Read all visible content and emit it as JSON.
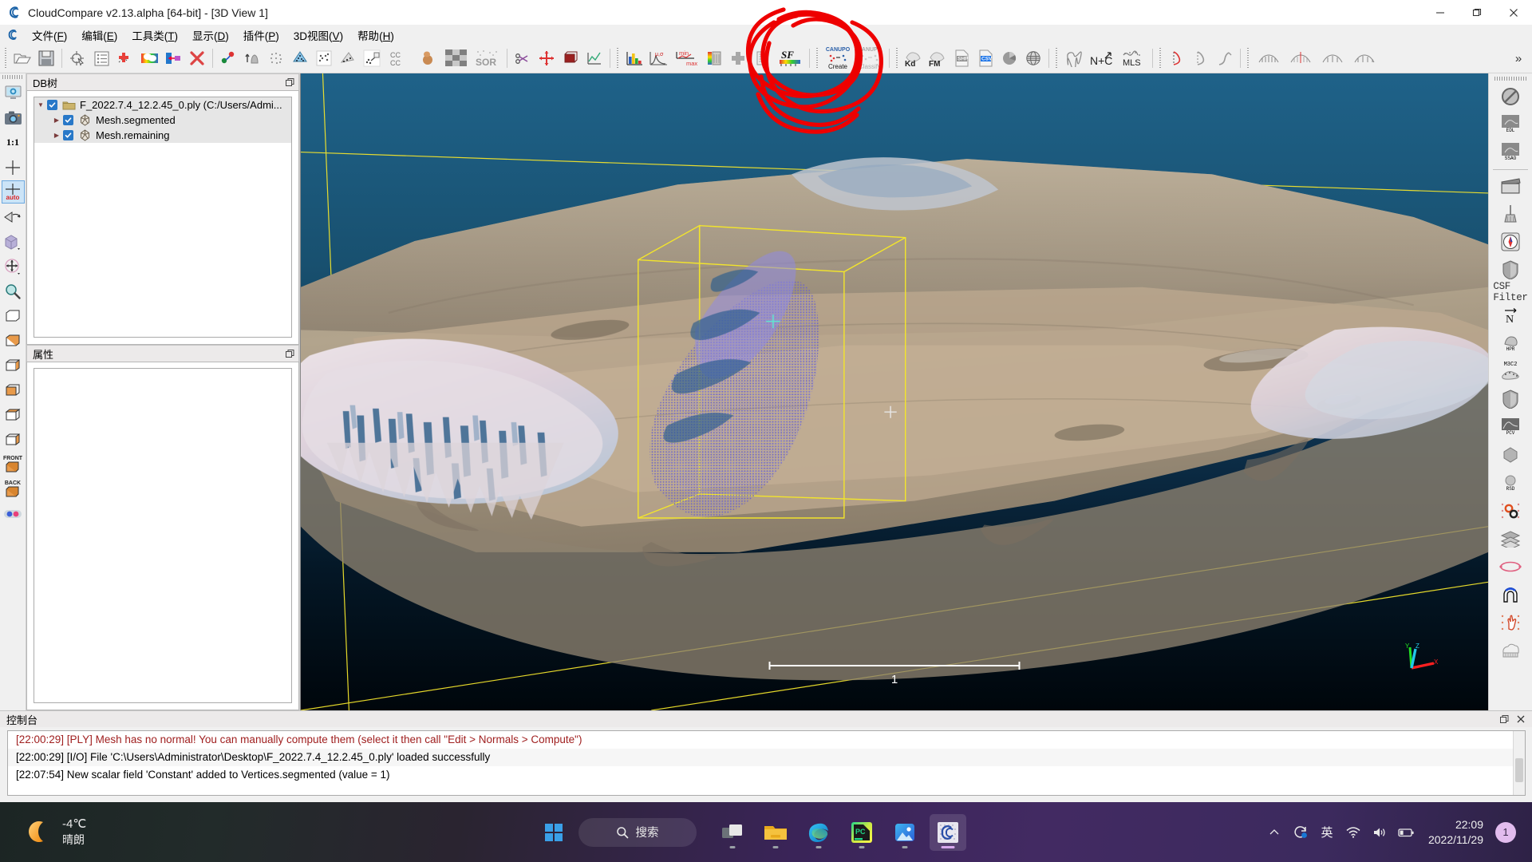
{
  "window": {
    "title": "CloudCompare v2.13.alpha [64-bit] - [3D View 1]",
    "logo_icon": "cloudcompare-logo-icon",
    "minimize_label": "—",
    "maximize_label": "❐",
    "close_label": "✕"
  },
  "menubar": {
    "logo_icon": "cloudcompare-menu-icon",
    "items": [
      {
        "label": "文件",
        "key": "F"
      },
      {
        "label": "编辑",
        "key": "E"
      },
      {
        "label": "工具类",
        "key": "T"
      },
      {
        "label": "显示",
        "key": "D"
      },
      {
        "label": "插件",
        "key": "P"
      },
      {
        "label": "3D视图",
        "key": "V"
      },
      {
        "label": "帮助",
        "key": "H"
      }
    ]
  },
  "toolbar": {
    "groups": [
      {
        "icons": [
          "open-file-icon",
          "save-file-icon"
        ]
      },
      {
        "icons": [
          "pick-point-icon",
          "properties-list-icon",
          "add-point-icon",
          "rainbow-colors-icon",
          "export-icon",
          "delete-icon"
        ]
      },
      {
        "icons": [
          "clone-icon",
          "normals-up-icon",
          "subsample-icon",
          "mesh-icon",
          "scatter-match-icon",
          "register-icon",
          "align-icon",
          "cloud-cloud-dist-icon",
          "ball-icon",
          "checker-icon",
          "sor-filter-icon"
        ]
      },
      {
        "icons": [
          "scissors-icon",
          "translate-rotate-icon",
          "bounding-box-icon",
          "plot-icon"
        ]
      },
      {
        "icons": [
          "histogram-icon",
          "gauss-fit-icon",
          "min-max-icon",
          "gradient-icon",
          "add-sf-icon",
          "sf-list-icon",
          "sf-color-icon"
        ]
      },
      {
        "icons": [
          "canupo-create-icon",
          "canupo-classify-icon"
        ]
      },
      {
        "icons": [
          "kdtree-icon",
          "fast-marching-icon",
          "shp-icon",
          "csv-icon",
          "pie-icon",
          "globe-icon"
        ]
      },
      {
        "icons": [
          "polygon-icon",
          "normals-compute-icon",
          "mls-icon"
        ]
      },
      {
        "icons": [
          "curve-icon",
          "curve2-icon",
          "curve3-icon"
        ]
      },
      {
        "icons": [
          "section-icon",
          "section2-icon",
          "section3-icon",
          "section4-icon"
        ]
      }
    ],
    "canupo_create_label": "CANUPO",
    "canupo_create_sub": "Create",
    "canupo_classify_label": "CANUPO",
    "canupo_classify_sub": "Classify",
    "kd_label": "Kd",
    "fm_label": "FM",
    "shp_label": "SHP",
    "csv_label": "CSV",
    "nc_label": "N+C",
    "mls_label": "MLS",
    "sf_label": "SF",
    "sor_label": "SOR",
    "cc_label": "CC",
    "minmax_min": "min",
    "minmax_max": "max",
    "gauss_label": "μ,σ",
    "overflow_label": "»"
  },
  "left_rail": {
    "items": [
      {
        "icon": "display-settings-icon",
        "label": ""
      },
      {
        "icon": "camera-snapshot-icon",
        "label": ""
      },
      {
        "icon": "zoom-1to1-icon",
        "label": "1:1"
      },
      {
        "icon": "set-pivot-icon",
        "label": ""
      },
      {
        "icon": "auto-pivot-icon",
        "label": "auto",
        "selected": true
      },
      {
        "icon": "rotate-view-icon",
        "label": ""
      },
      {
        "icon": "cube-view-icon",
        "label": ""
      },
      {
        "icon": "pan-view-icon",
        "label": ""
      },
      {
        "icon": "zoom-icon",
        "label": ""
      },
      {
        "icon": "view-top-icon",
        "label": ""
      },
      {
        "icon": "view-bottom-icon",
        "label": ""
      },
      {
        "icon": "view-left-icon",
        "label": ""
      },
      {
        "icon": "view-right-icon",
        "label": ""
      },
      {
        "icon": "view-iso1-icon",
        "label": ""
      },
      {
        "icon": "view-iso2-icon",
        "label": ""
      },
      {
        "icon": "view-front-icon",
        "label": "FRONT"
      },
      {
        "icon": "view-back-icon",
        "label": "BACK"
      },
      {
        "icon": "stereo-mode-icon",
        "label": ""
      }
    ]
  },
  "right_rail": {
    "items": [
      {
        "icon": "no-filter-icon",
        "label": ""
      },
      {
        "icon": "edl-shader-icon",
        "label": "EDL"
      },
      {
        "icon": "ssao-shader-icon",
        "label": "SSAO"
      },
      {
        "icon": "animation-icon",
        "label": ""
      },
      {
        "icon": "broom-cleaner-icon",
        "label": ""
      },
      {
        "icon": "compass-icon",
        "label": ""
      },
      {
        "icon": "shield-icon",
        "label": ""
      },
      {
        "icon": "csf-filter-icon",
        "label": "CSF Filter"
      },
      {
        "icon": "normal-vector-icon",
        "label": "N"
      },
      {
        "icon": "hpr-icon",
        "label": "HPR"
      },
      {
        "icon": "m3c2-icon",
        "label": "M3C2"
      },
      {
        "icon": "shield2-icon",
        "label": ""
      },
      {
        "icon": "pcv-icon",
        "label": "PCV"
      },
      {
        "icon": "polyhedron-icon",
        "label": ""
      },
      {
        "icon": "rsd-icon",
        "label": "RSD"
      },
      {
        "icon": "gears-icon",
        "label": ""
      },
      {
        "icon": "layers-icon",
        "label": ""
      },
      {
        "icon": "ellipse-icon",
        "label": ""
      },
      {
        "icon": "tunnel-icon",
        "label": ""
      },
      {
        "icon": "hand-pick-icon",
        "label": ""
      },
      {
        "icon": "cloud-comb-icon",
        "label": ""
      }
    ]
  },
  "db_panel": {
    "title": "DB树",
    "float_icon": "float-panel-icon",
    "tree": [
      {
        "label": "F_2022.7.4_12.2.45_0.ply (C:/Users/Admi...",
        "icon": "folder-icon",
        "arrow": "down",
        "depth": 0,
        "checked": true
      },
      {
        "label": "Mesh.segmented",
        "icon": "mesh-icon",
        "arrow": "right",
        "depth": 1,
        "checked": true
      },
      {
        "label": "Mesh.remaining",
        "icon": "mesh-icon",
        "arrow": "right",
        "depth": 1,
        "checked": true
      }
    ]
  },
  "props_panel": {
    "title": "属性",
    "float_icon": "float-panel-icon",
    "rows": []
  },
  "console": {
    "title": "控制台",
    "float_icon": "float-panel-icon",
    "close_icon": "close-icon",
    "lines": [
      {
        "text": "[22:00:29] [PLY] Mesh has no normal! You can manually compute them (select it then call \"Edit > Normals > Compute\")",
        "type": "warn"
      },
      {
        "text": "[22:00:29] [I/O] File 'C:\\Users\\Administrator\\Desktop\\F_2022.7.4_12.2.45_0.ply' loaded successfully",
        "type": "info"
      },
      {
        "text": "[22:07:54] New scalar field 'Constant' added to Vertices.segmented (value = 1)",
        "type": "info"
      }
    ]
  },
  "viewport": {
    "scalebar_label": "1",
    "axis_x": "X",
    "axis_y": "Y",
    "axis_z": "Z",
    "background_top": "#1d5f86",
    "background_bottom": "#000306"
  },
  "taskbar": {
    "weather": {
      "icon": "moon-icon",
      "temp": "-4℃",
      "condition": "晴朗"
    },
    "start_icon": "windows-start-icon",
    "search": {
      "icon": "search-icon",
      "label": "搜索"
    },
    "apps": [
      {
        "icon": "task-view-icon",
        "name": "task-view",
        "running": true,
        "active": false
      },
      {
        "icon": "file-explorer-icon",
        "name": "file-explorer",
        "running": true,
        "active": false
      },
      {
        "icon": "edge-icon",
        "name": "microsoft-edge",
        "running": true,
        "active": false
      },
      {
        "icon": "pycharm-icon",
        "name": "pycharm",
        "running": true,
        "active": false
      },
      {
        "icon": "photos-icon",
        "name": "photos",
        "running": true,
        "active": false
      },
      {
        "icon": "cloudcompare-icon",
        "name": "cloudcompare",
        "running": true,
        "active": true
      }
    ],
    "tray": [
      {
        "icon": "chevron-up-icon",
        "name": "show-hidden-icons"
      },
      {
        "icon": "sync-icon",
        "name": "onedrive-sync"
      },
      {
        "icon": "ime-icon",
        "name": "input-method",
        "label": "英"
      },
      {
        "icon": "wifi-icon",
        "name": "network"
      },
      {
        "icon": "volume-icon",
        "name": "volume"
      },
      {
        "icon": "battery-icon",
        "name": "battery"
      }
    ],
    "clock": {
      "time": "22:09",
      "date": "2022/11/29"
    },
    "notification_count": "1"
  }
}
